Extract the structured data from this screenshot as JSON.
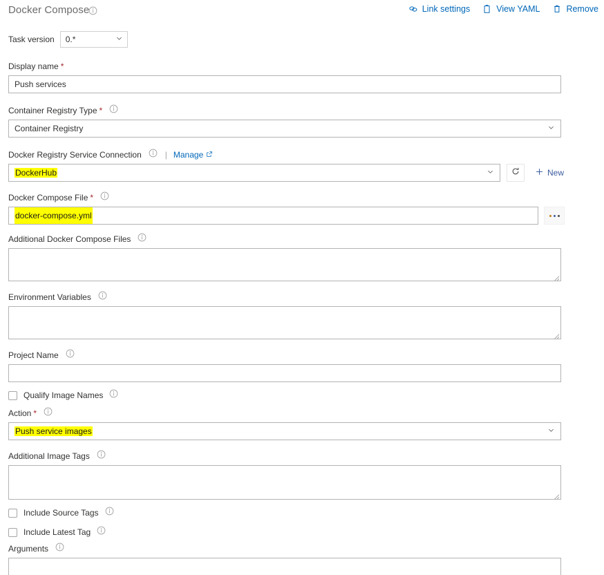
{
  "header": {
    "title": "Docker Compose",
    "title_info_icon": "info-icon",
    "actions": [
      {
        "label": "Link settings",
        "icon": "link-icon"
      },
      {
        "label": "View YAML",
        "icon": "clipboard-icon"
      },
      {
        "label": "Remove",
        "icon": "trash-icon"
      }
    ]
  },
  "task_version": {
    "label": "Task version",
    "value": "0.*",
    "chevron_icon": "chevron-down-icon"
  },
  "fields": {
    "display_name": {
      "label": "Display name",
      "required": "*",
      "value": "Push services"
    },
    "container_registry_type": {
      "label": "Container Registry Type",
      "required": "*",
      "info_icon": "info-icon",
      "value": "Container Registry",
      "chevron_icon": "chevron-down-icon"
    },
    "docker_registry_service_connection": {
      "label": "Docker Registry Service Connection",
      "info_icon": "info-icon",
      "separator": "|",
      "manage_label": "Manage",
      "manage_icon": "external-link-icon",
      "value": "DockerHub",
      "value_highlighted": true,
      "chevron_icon": "chevron-down-icon",
      "refresh_icon": "refresh-icon",
      "new_label": "New",
      "new_icon": "plus-icon"
    },
    "docker_compose_file": {
      "label": "Docker Compose File",
      "required": "*",
      "info_icon": "info-icon",
      "value": "docker-compose.yml",
      "value_highlighted": true,
      "browse_icon": "ellipsis-icon"
    },
    "additional_docker_compose_files": {
      "label": "Additional Docker Compose Files",
      "info_icon": "info-icon",
      "value": ""
    },
    "environment_variables": {
      "label": "Environment Variables",
      "info_icon": "info-icon",
      "value": ""
    },
    "project_name": {
      "label": "Project Name",
      "info_icon": "info-icon",
      "value": ""
    },
    "qualify_image_names": {
      "label": "Qualify Image Names",
      "info_icon": "info-icon",
      "checked": false
    },
    "action": {
      "label": "Action",
      "required": "*",
      "info_icon": "info-icon",
      "value": "Push service images",
      "value_highlighted": true,
      "chevron_icon": "chevron-down-icon"
    },
    "additional_image_tags": {
      "label": "Additional Image Tags",
      "info_icon": "info-icon",
      "value": ""
    },
    "include_source_tags": {
      "label": "Include Source Tags",
      "info_icon": "info-icon",
      "checked": false
    },
    "include_latest_tag": {
      "label": "Include Latest Tag",
      "info_icon": "info-icon",
      "checked": false
    },
    "arguments": {
      "label": "Arguments",
      "info_icon": "info-icon",
      "value": ""
    }
  },
  "colors": {
    "link_blue": "#0067b8",
    "required_red": "#a4262c",
    "highlight_yellow": "#ffff00",
    "border_gray": "#b3b3b3",
    "text": "#323130"
  }
}
